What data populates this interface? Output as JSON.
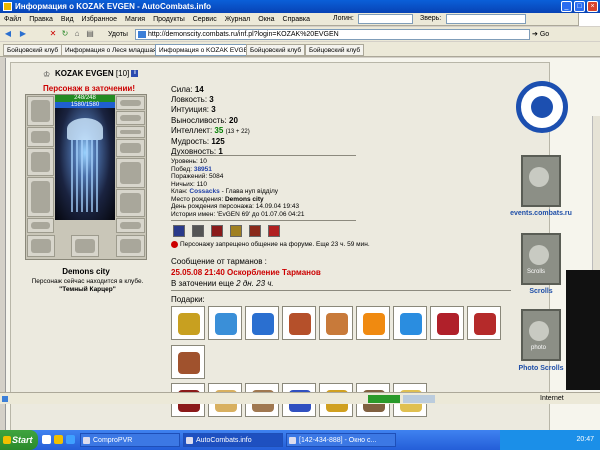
{
  "window": {
    "title": "Информация о KOZAK EVGEN - AutoCombats.info"
  },
  "menu": [
    "Файл",
    "Правка",
    "Вид",
    "Избранное",
    "Магия",
    "Продукты",
    "Сервис",
    "Журнал",
    "Окна",
    "Справка"
  ],
  "login": {
    "label": "Логин:",
    "pass_label": "Зверь:"
  },
  "nav": {
    "back": "Назад",
    "udots": "Удоты"
  },
  "address": {
    "url": "http://demonscity.combats.ru/inf.pl?login=KOZAK%20EVGEN",
    "go": "Go"
  },
  "tabs": [
    "Бойцовский клуб",
    "Информация о Леся младшая",
    "Информация о KOZAK EVGEN",
    "Бойцовский клуб",
    "Бойцовский клуб"
  ],
  "character": {
    "name": "KOZAK EVGEN",
    "level": "[10]",
    "prison_text": "Персонаж в заточении!",
    "hp": "248/248",
    "mp": "1580/1580",
    "city": "Demons city",
    "location_line1": "Персонаж сейчас находится в клубе.",
    "location_line2": "\"Темный Карцер\""
  },
  "stats": [
    {
      "label": "Сила:",
      "value": "14"
    },
    {
      "label": "Ловкость:",
      "value": "3"
    },
    {
      "label": "Интуиция:",
      "value": "3"
    },
    {
      "label": "Выносливость:",
      "value": "20"
    },
    {
      "label": "Интеллект:",
      "value": "35",
      "extra": "(13 + 22)"
    },
    {
      "label": "Мудрость:",
      "value": "125"
    },
    {
      "label": "Духовность:",
      "value": "1"
    }
  ],
  "info": {
    "level": "Уровень: 10",
    "wins_label": "Побед:",
    "wins": "38951",
    "losses": "Поражений: 5084",
    "draws": "Ничьих: 110",
    "clan_label": "Клан:",
    "clan": "Cossacks",
    "clan_role": "- Глава нуп відділу",
    "birthplace_label": "Место рождения:",
    "birthplace": "Demons city",
    "birthday": "День рождения персонажа: 14.09.04 19:43",
    "history": "История имен: 'EvGEN 69' до 01.07.06 04:21"
  },
  "forum_ban": "Персонажу запрещено общение на форуме. Еще 23 ч. 59 мин.",
  "messages": {
    "header": "Сообщение от тарманов :",
    "text": "25.05.08 21:40 Оскорбление Тарманов",
    "jail_prefix": "В заточении еще",
    "jail_time": "2 дн. 23 ч."
  },
  "gifts_label": "Подарки:",
  "gift_colors": [
    "#c8a020",
    "#3a8fd8",
    "#2a6fd0",
    "#b5502a",
    "#c87a3a",
    "#f08a10",
    "#2a8de0",
    "#b0202a",
    "#b52a2a",
    "#a0522d"
  ],
  "gift_colors_row2": [
    "#8b1a1a",
    "#d8b060",
    "#a07850",
    "#3050c0",
    "#d0a020",
    "#806040",
    "#e0c050"
  ],
  "right": {
    "events_label": "events.combats.ru",
    "scrolls_label": "Scrolls",
    "photo_label": "Photo Scrolls",
    "scrolls_text": "Scrolls",
    "photo_text": "photo"
  },
  "status": {
    "zone": "Internet"
  },
  "taskbar": {
    "start": "Start",
    "tasks": [
      "",
      "ComproPVR",
      "AutoCombats.info",
      "[142-434-888] - Окно с..."
    ],
    "clock": "20:47"
  }
}
